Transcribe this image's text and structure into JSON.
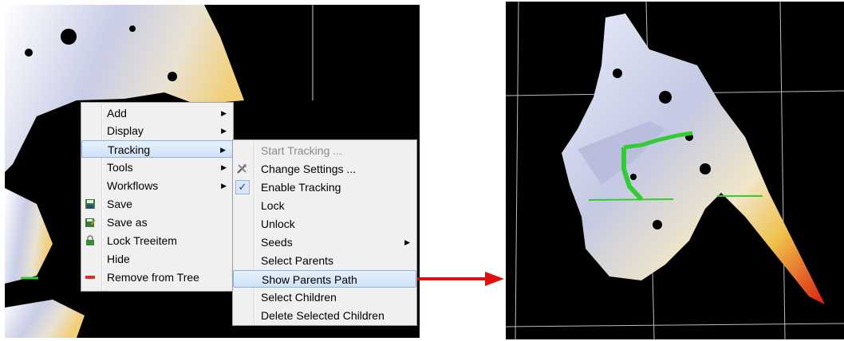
{
  "context_menu": {
    "items": [
      {
        "label": "Add",
        "submenu": true
      },
      {
        "label": "Display",
        "submenu": true
      },
      {
        "label": "Tracking",
        "submenu": true,
        "highlighted": true
      },
      {
        "label": "Tools",
        "submenu": true
      },
      {
        "label": "Workflows",
        "submenu": true
      },
      {
        "label": "Save",
        "icon": "floppy-disk-icon"
      },
      {
        "label": "Save as",
        "icon": "save-as-icon"
      },
      {
        "label": "Lock Treeitem",
        "icon": "padlock-icon"
      },
      {
        "label": "Hide"
      },
      {
        "label": "Remove from Tree",
        "icon": "red-minus-icon"
      }
    ]
  },
  "tracking_submenu": {
    "items": [
      {
        "label": "Start Tracking ...",
        "disabled": true
      },
      {
        "label": "Change Settings ...",
        "icon": "tools-icon"
      },
      {
        "label": "Enable Tracking",
        "checked": true
      },
      {
        "label": "Lock"
      },
      {
        "label": "Unlock"
      },
      {
        "label": "Seeds",
        "submenu": true
      },
      {
        "label": "Select Parents"
      },
      {
        "label": "Show Parents Path",
        "highlighted": true
      },
      {
        "label": "Select Children"
      },
      {
        "label": "Delete Selected Children"
      }
    ]
  },
  "colors": {
    "viewport_bg": "#000000",
    "menu_bg": "#f0f0f0",
    "highlight": "#cfe2f7",
    "arrow": "#e01010",
    "path_green": "#33cc33",
    "disabled_text": "#8a8a8a"
  }
}
